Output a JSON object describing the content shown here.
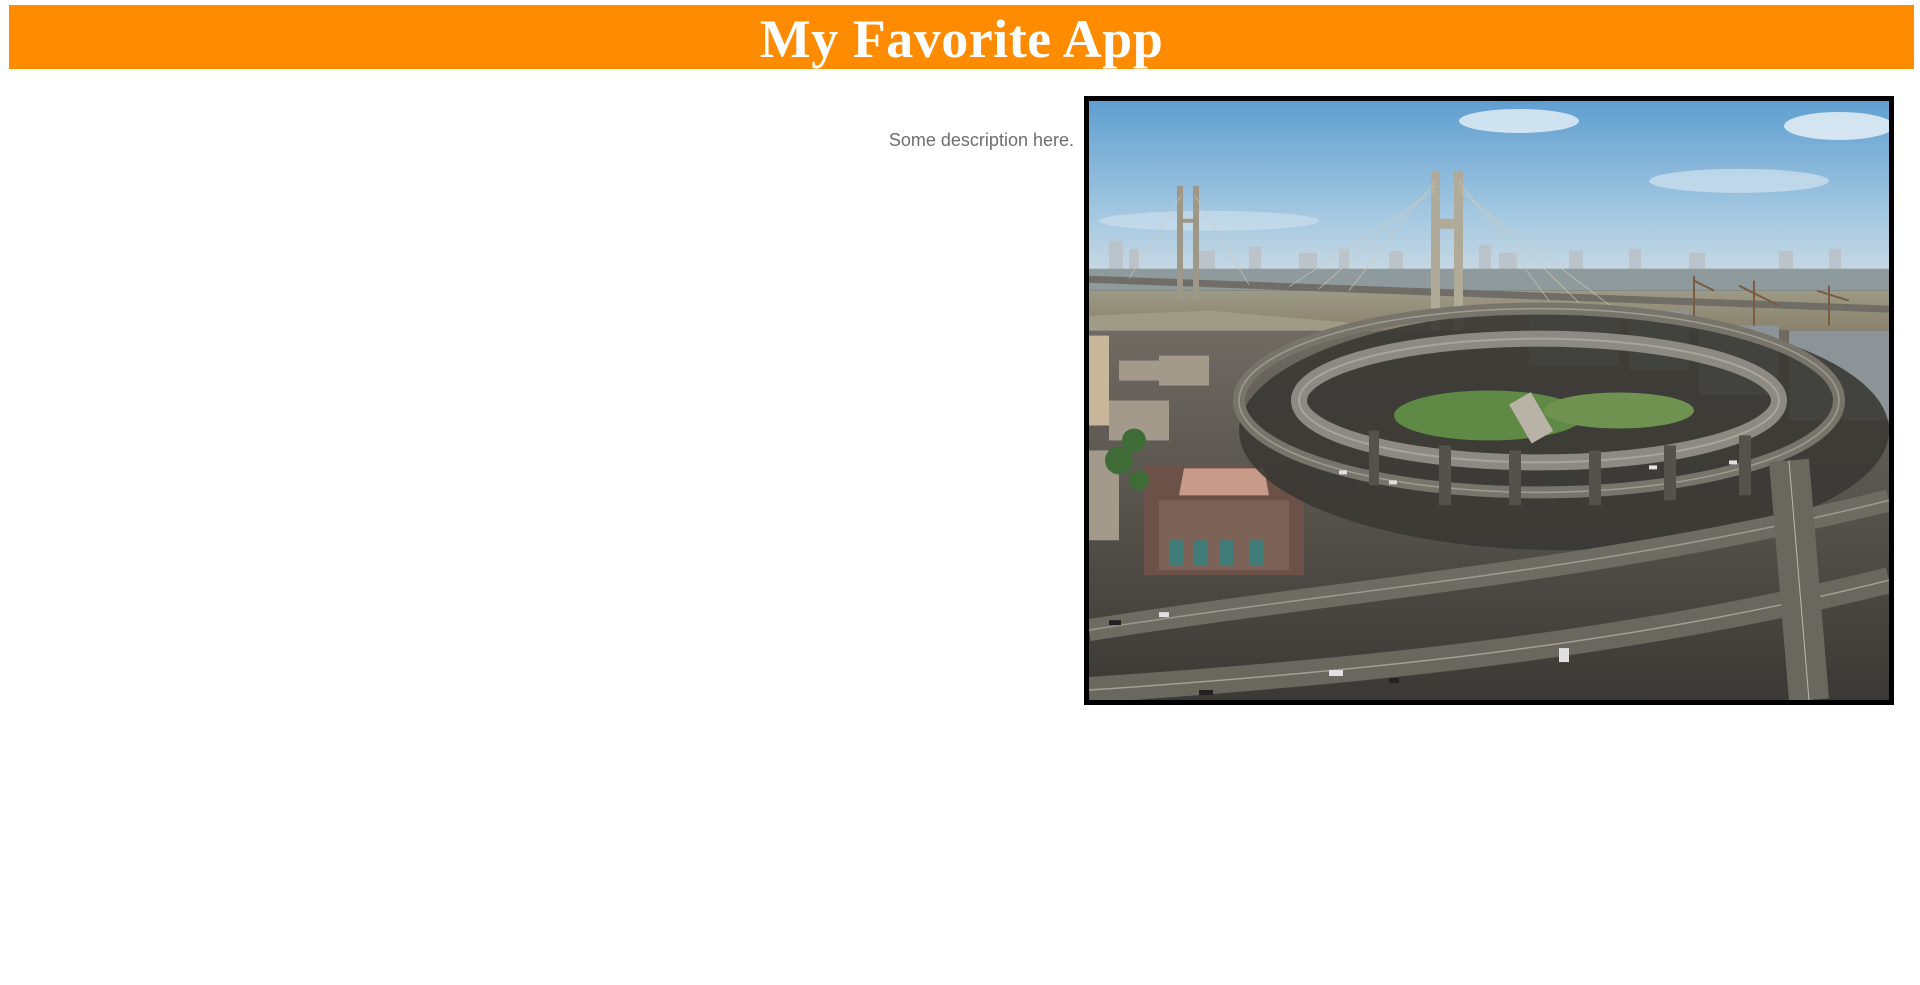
{
  "app": {
    "title": "My Favorite App"
  },
  "content": {
    "description": "Some description here.",
    "image": {
      "subject": "aerial view of a cable-stayed bridge over a river with a spiral elevated highway interchange in a city"
    }
  },
  "colors": {
    "header_background": "#ff8c00",
    "header_text": "#ffffff",
    "description_text": "#6e6e6e",
    "image_border": "#000000"
  }
}
